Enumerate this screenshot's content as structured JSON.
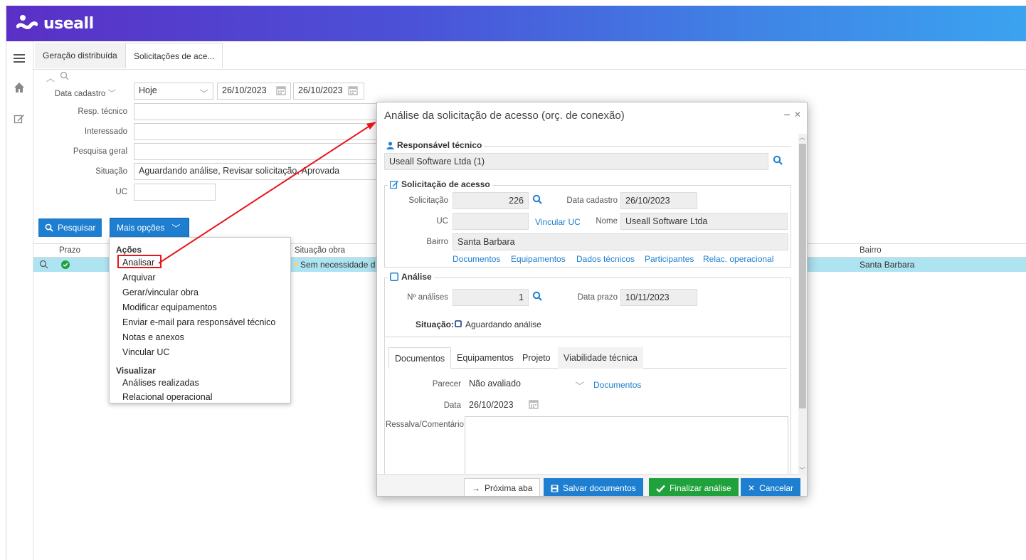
{
  "brand": {
    "name": "useall"
  },
  "sidebar": {
    "icons": [
      "menu-icon",
      "home-icon",
      "edit-icon"
    ]
  },
  "tabs": [
    {
      "label": "Geração distribuída"
    },
    {
      "label": "Solicitações de ace..."
    }
  ],
  "filters": {
    "data_cadastro_label": "Data cadastro",
    "periodo": "Hoje",
    "data_inicio": "26/10/2023",
    "data_fim": "26/10/2023",
    "resp_tecnico_label": "Resp. técnico",
    "interessado_label": "Interessado",
    "pesquisa_geral_label": "Pesquisa geral",
    "situacao_label": "Situação",
    "situacao_value": "Aguardando análise, Revisar solicitação, Aprovada",
    "uc_label": "UC"
  },
  "buttons": {
    "pesquisar": "Pesquisar",
    "mais_opcoes": "Mais opções"
  },
  "grid": {
    "headers": {
      "prazo": "Prazo",
      "situacao_obra": "Situação obra",
      "bairro": "Bairro"
    },
    "row": {
      "situacao_obra": "Sem necessidade d",
      "bairro": "Santa Barbara"
    }
  },
  "menu": {
    "acoes_header": "Ações",
    "acoes": [
      "Analisar",
      "Arquivar",
      "Gerar/vincular obra",
      "Modificar equipamentos",
      "Enviar e-mail para responsável técnico",
      "Notas e anexos",
      "Vincular UC"
    ],
    "visualizar_header": "Visualizar",
    "visualizar": [
      "Análises realizadas",
      "Relacional operacional"
    ]
  },
  "modal": {
    "title": "Análise da solicitação de acesso (orç. de conexão)",
    "resp_legend": "Responsável técnico",
    "resp_value": "Useall Software Ltda (1)",
    "sol_legend": "Solicitação de acesso",
    "solicitacao_label": "Solicitação",
    "solicitacao_value": "226",
    "data_cadastro_label": "Data cadastro",
    "data_cadastro_value": "26/10/2023",
    "uc_label": "UC",
    "vincular_uc": "Vincular UC",
    "nome_label": "Nome",
    "nome_value": "Useall Software Ltda",
    "bairro_label": "Bairro",
    "bairro_value": "Santa Barbara",
    "links": [
      "Documentos",
      "Equipamentos",
      "Dados técnicos",
      "Participantes",
      "Relac. operacional"
    ],
    "analise_legend": "Análise",
    "n_analises_label": "Nº análises",
    "n_analises_value": "1",
    "data_prazo_label": "Data prazo",
    "data_prazo_value": "10/11/2023",
    "situacao_label": "Situação:",
    "situacao_value": "Aguardando análise",
    "tabs": [
      "Documentos",
      "Equipamentos",
      "Projeto",
      "Viabilidade técnica"
    ],
    "parecer_label": "Parecer",
    "parecer_value": "Não avaliado",
    "documentos_link": "Documentos",
    "data_label": "Data",
    "data_value": "26/10/2023",
    "ressalva_label": "Ressalva/Comentário",
    "footer": {
      "proxima": "Próxima aba",
      "salvar": "Salvar documentos",
      "finalizar": "Finalizar análise",
      "cancelar": "Cancelar"
    }
  },
  "colors": {
    "accent": "#1e7fd0",
    "success": "#1fa13b",
    "highlight_row": "#aee3f1",
    "annotation": "#e8141b"
  }
}
